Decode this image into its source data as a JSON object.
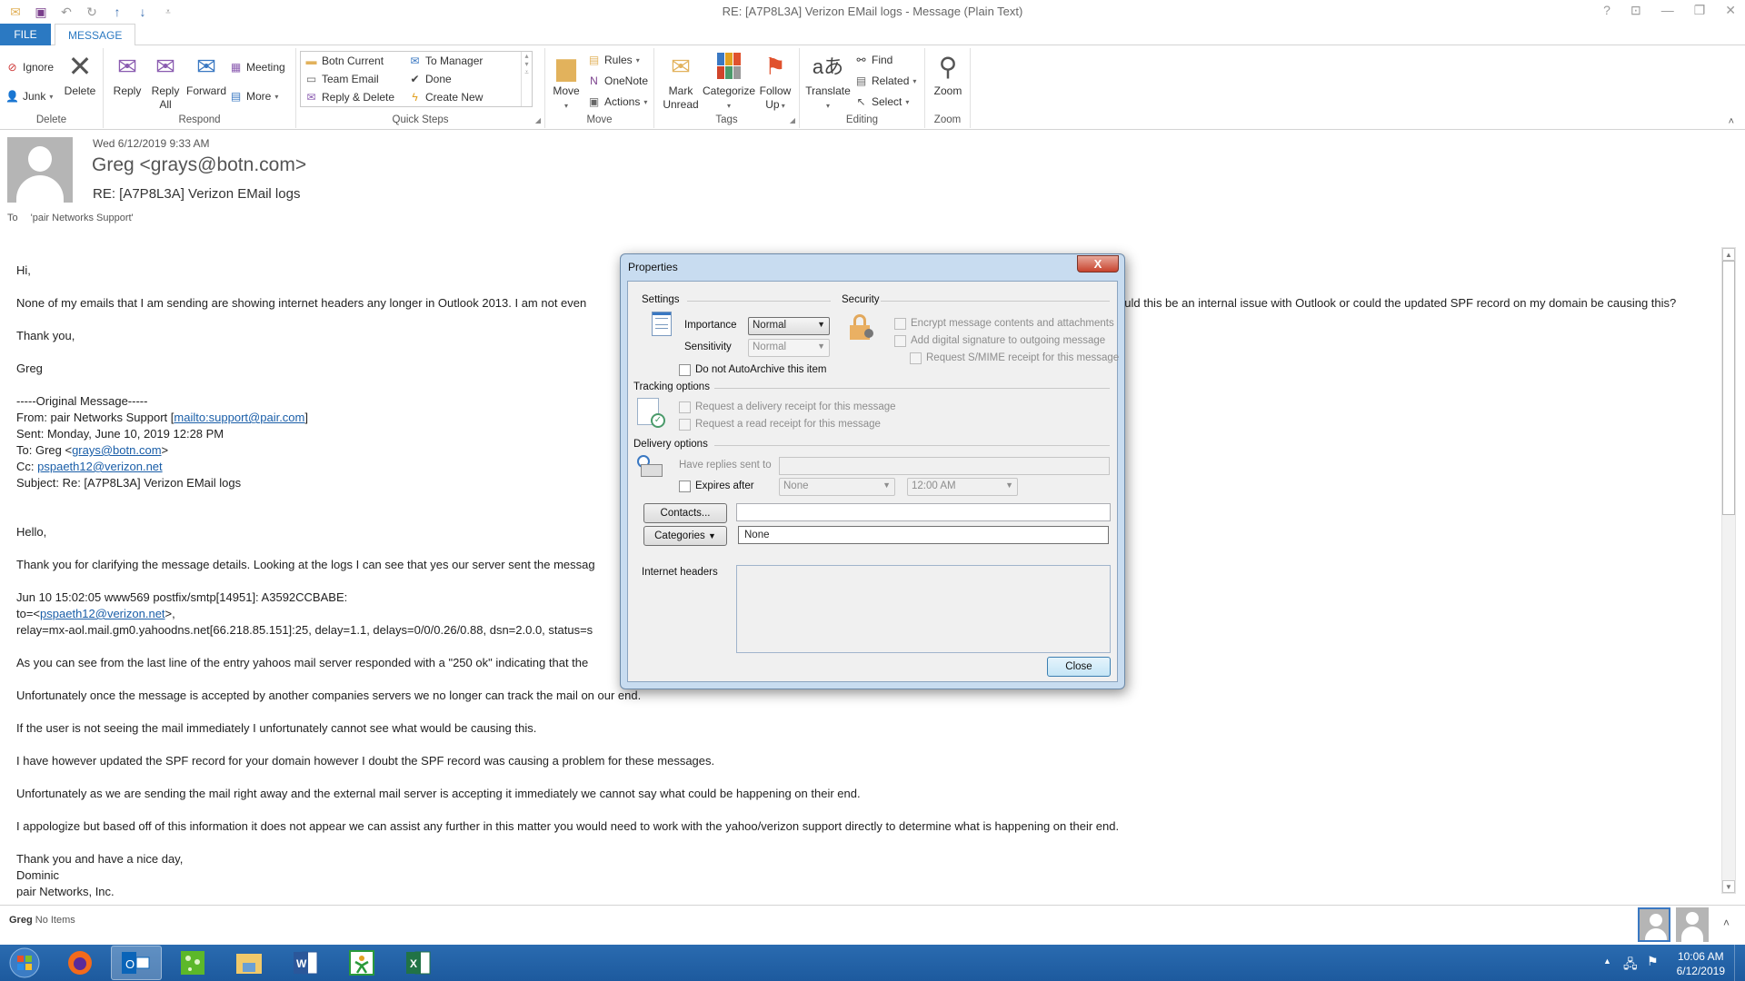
{
  "window": {
    "title": "RE: [A7P8L3A] Verizon EMail logs - Message (Plain Text)",
    "controls": [
      "?",
      "ribbon-display",
      "minimize",
      "restore",
      "close"
    ]
  },
  "quick_access": [
    "mail-icon",
    "save-icon",
    "undo-icon",
    "redo-icon",
    "up-arrow-icon",
    "down-arrow-icon",
    "customize-icon"
  ],
  "tabs": [
    {
      "label": "FILE"
    },
    {
      "label": "MESSAGE"
    }
  ],
  "ribbon": {
    "delete": {
      "label": "Delete",
      "ignore": "Ignore",
      "junk": "Junk",
      "delete_btn": "Delete"
    },
    "respond": {
      "label": "Respond",
      "reply": "Reply",
      "reply_all_1": "Reply",
      "reply_all_2": "All",
      "forward": "Forward",
      "meeting": "Meeting",
      "more": "More"
    },
    "quick_steps": {
      "label": "Quick Steps",
      "items": [
        "Botn Current",
        "To Manager",
        "Team Email",
        "Done",
        "Reply & Delete",
        "Create New"
      ]
    },
    "move": {
      "label": "Move",
      "move_btn": "Move",
      "rules": "Rules",
      "onenote": "OneNote",
      "actions": "Actions"
    },
    "tags": {
      "label": "Tags",
      "mark_unread_1": "Mark",
      "mark_unread_2": "Unread",
      "categorize": "Categorize",
      "follow_up_1": "Follow",
      "follow_up_2": "Up"
    },
    "editing": {
      "label": "Editing",
      "translate": "Translate",
      "find": "Find",
      "related": "Related",
      "select": "Select"
    },
    "zoom": {
      "label": "Zoom",
      "zoom_btn": "Zoom"
    }
  },
  "message": {
    "date": "Wed 6/12/2019 9:33 AM",
    "from": "Greg <grays@botn.com>",
    "subject": "RE: [A7P8L3A] Verizon EMail logs",
    "to_label": "To",
    "to_value": "'pair Networks Support'"
  },
  "body": {
    "greeting": "Hi,",
    "p1a": "None of my emails that I am sending are showing internet headers any longer in Outlook 2013.  I am not even",
    "p1b": "uld this be an internal issue with Outlook or could the updated SPF record on my domain be causing this?",
    "thanks": "Thank you,",
    "sig": "Greg",
    "orig": "-----Original Message-----",
    "from_prefix": "From: pair Networks Support [",
    "from_link": "mailto:support@pair.com",
    "from_suffix": "]",
    "sent": "Sent: Monday, June 10, 2019 12:28 PM",
    "to_prefix": "To: Greg <",
    "to_link": "grays@botn.com",
    "to_suffix": ">",
    "cc_prefix": "Cc: ",
    "cc_link": "pspaeth12@verizon.net",
    "subj": "Subject: Re: [A7P8L3A] Verizon EMail logs",
    "hello": "Hello,",
    "p2": "Thank you for clarifying the message details. Looking at the logs I can see that yes our server sent the messag",
    "log1": "Jun 10 15:02:05 www569 postfix/smtp[14951]: A3592CCBABE:",
    "log2_prefix": "to=<",
    "log2_link": "pspaeth12@verizon.net",
    "log2_suffix": ">,",
    "log3": "relay=mx-aol.mail.gm0.yahoodns.net[66.218.85.151]:25, delay=1.1, delays=0/0/0.26/0.88, dsn=2.0.0, status=s",
    "p3": "As you can see from the last line of the entry yahoos mail server responded with a \"250 ok\" indicating that the",
    "p4": "Unfortunately once the message is accepted by another companies servers we no longer can track the mail on our end.",
    "p5": "If the user is not seeing the mail immediately I unfortunately cannot see what would be causing this.",
    "p6": "I have however updated the SPF record for your domain however I doubt the SPF record was causing a problem for these messages.",
    "p7": "Unfortunately as we are sending the mail right away and the external mail server is accepting it immediately we cannot say what could be happening on their end.",
    "p8": "I appologize but based off of this information it does not appear we can assist any further in this matter you would need to work with the yahoo/verizon support directly to determine what is happening on their end.",
    "closing": "Thank you and have a nice day,",
    "name": "Dominic",
    "company": "pair Networks, Inc."
  },
  "people_pane": {
    "name": "Greg",
    "status": "No Items"
  },
  "dialog": {
    "title": "Properties",
    "close_x": "X",
    "settings_label": "Settings",
    "security_label": "Security",
    "importance_label": "Importance",
    "importance_value": "Normal",
    "sensitivity_label": "Sensitivity",
    "sensitivity_value": "Normal",
    "encrypt": "Encrypt message contents and attachments",
    "signature": "Add digital signature to outgoing message",
    "smime": "Request S/MIME receipt for this message",
    "autoarchive": "Do not AutoArchive this item",
    "tracking_label": "Tracking options",
    "delivery_receipt": "Request a delivery receipt for this message",
    "read_receipt": "Request a read receipt for this message",
    "delivery_label": "Delivery options",
    "replies_to": "Have replies sent to",
    "replies_value": "",
    "expires": "Expires after",
    "expires_date": "None",
    "expires_time": "12:00 AM",
    "contacts_btn": "Contacts...",
    "contacts_value": "",
    "categories_btn": "Categories",
    "categories_value": "None",
    "headers_label": "Internet headers",
    "headers_value": "",
    "close_btn": "Close"
  },
  "taskbar": {
    "apps": [
      "start",
      "firefox",
      "outlook",
      "app-green",
      "file-explorer",
      "word",
      "app-figure",
      "excel"
    ],
    "time": "10:06 AM",
    "date": "6/12/2019"
  }
}
